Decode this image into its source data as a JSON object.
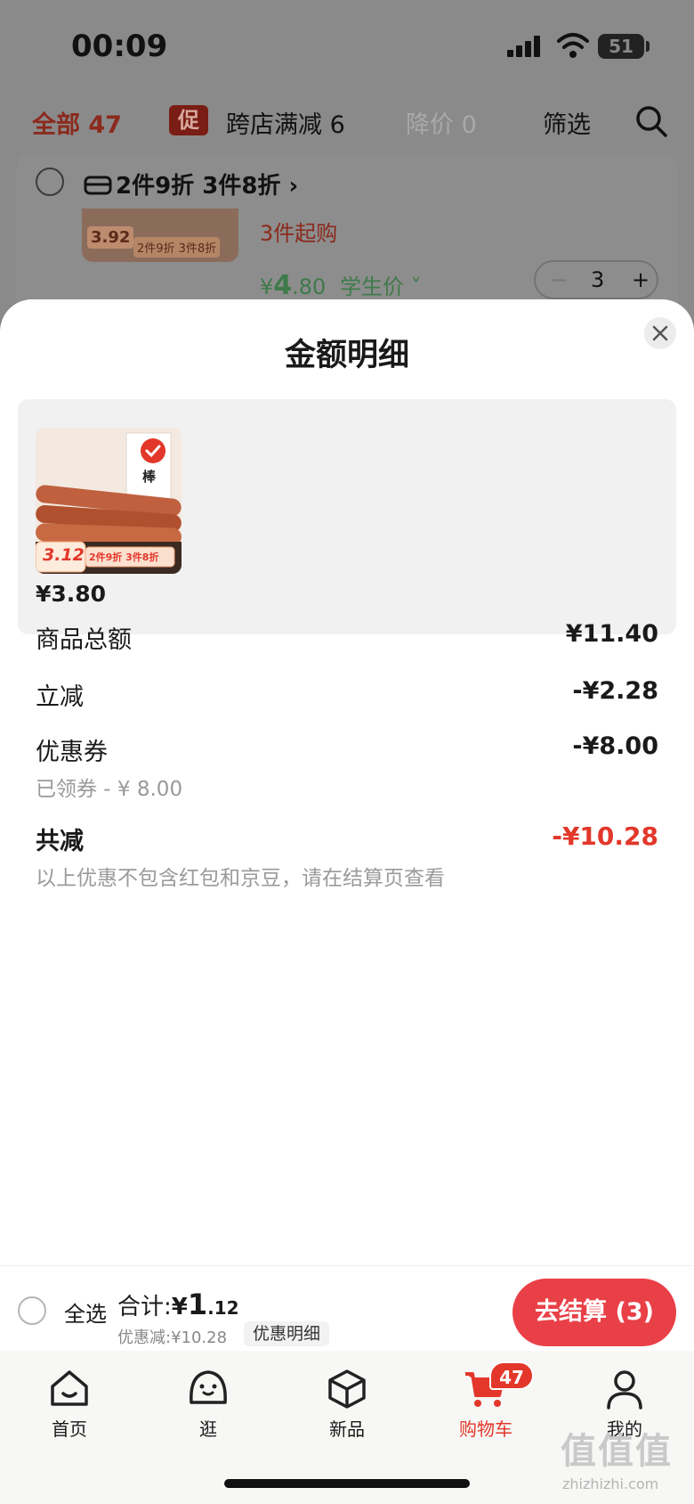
{
  "status_bar": {
    "time": "00:09",
    "battery": "51"
  },
  "filters": {
    "all": "全部 47",
    "promo_tag": "促",
    "cross_store": "跨店满减 6",
    "price_drop": "降价 0",
    "filter": "筛选"
  },
  "bg_card": {
    "discount_text": "2件9折 3件8折 ›",
    "thumb_price": "3.92",
    "thumb_promo": "2件9折 3件8折",
    "min_buy": "3件起购",
    "price_symbol": "¥",
    "price_int": "4",
    "price_dec": ".80",
    "price_label": "学生价 ˅",
    "stepper_minus": "−",
    "stepper_value": "3",
    "stepper_plus": "+"
  },
  "sheet": {
    "title": "金额明细",
    "product": {
      "price": "¥3.80",
      "image_price": "3.12",
      "image_promo": "2件9折 3件8折",
      "image_brand": "棒"
    },
    "rows": [
      {
        "label": "商品总额",
        "value": "¥11.40"
      },
      {
        "label": "立减",
        "value": "-¥2.28"
      },
      {
        "label": "优惠券",
        "value": "-¥8.00",
        "sub": "已领券 - ¥ 8.00"
      },
      {
        "label": "共减",
        "value": "-¥10.28",
        "sub": "以上优惠不包含红包和京豆，请在结算页查看"
      }
    ]
  },
  "bottom_bar": {
    "select_all": "全选",
    "total_label": "合计:",
    "total_symbol": "¥",
    "total_int": "1",
    "total_dec": ".12",
    "save_line": "优惠减:¥10.28",
    "detail_chip": "优惠明细",
    "checkout": "去结算 (3)"
  },
  "tabs": [
    {
      "label": "首页",
      "icon": "home-icon"
    },
    {
      "label": "逛",
      "icon": "face-icon"
    },
    {
      "label": "新品",
      "icon": "box-icon"
    },
    {
      "label": "购物车",
      "icon": "cart-icon",
      "badge": "47",
      "active": true
    },
    {
      "label": "我的",
      "icon": "user-icon"
    }
  ],
  "watermark": {
    "text": "值值值",
    "sub": "zhizhizhi.com"
  },
  "colors": {
    "accent": "#e2372a",
    "checkout": "#e94047",
    "green_price": "#3f7a4a"
  }
}
